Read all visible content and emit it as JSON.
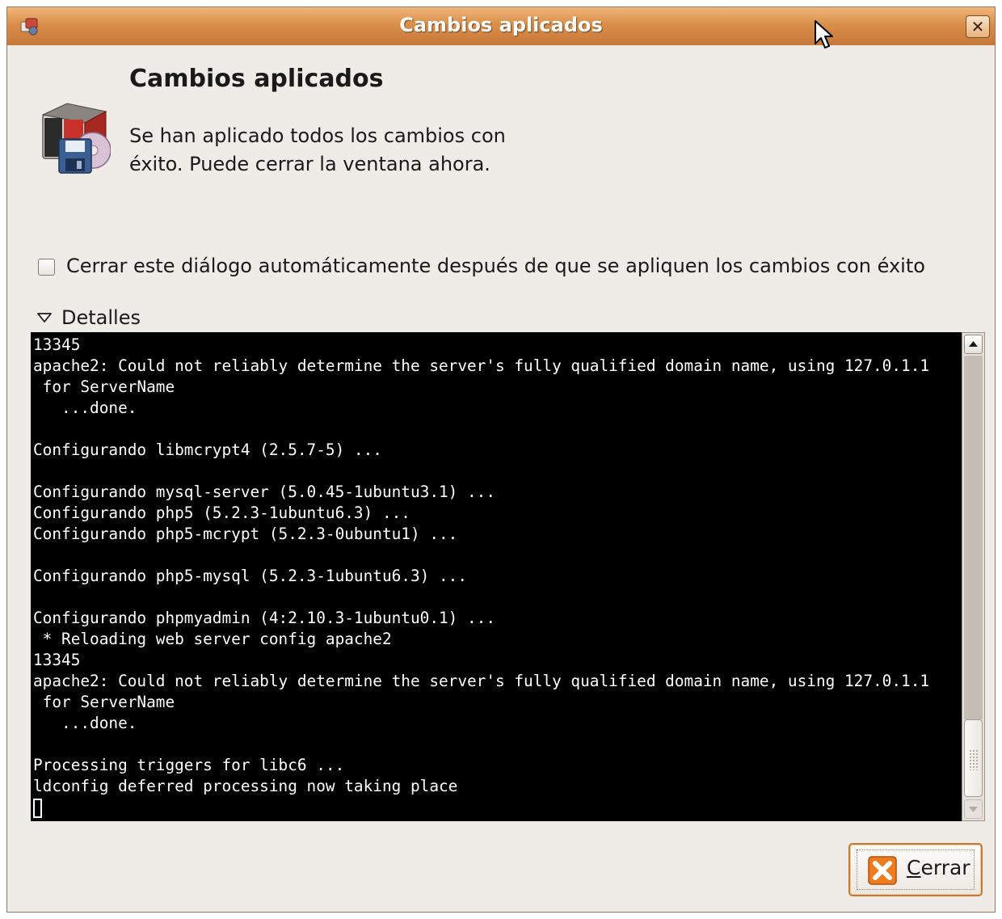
{
  "window": {
    "title": "Cambios aplicados",
    "close_glyph": "✕",
    "icons": [
      "window-menu-icon",
      "close-icon",
      "mouse-cursor-icon"
    ]
  },
  "dialog": {
    "heading": "Cambios aplicados",
    "message": "Se han aplicado todos los cambios con éxito. Puede cerrar la ventana ahora.",
    "icon": "package-installer-icon",
    "auto_close_checkbox": {
      "label": "Cerrar este diálogo automáticamente después de que se apliquen los cambios con éxito",
      "checked": false
    },
    "details": {
      "label": "Detalles",
      "expanded": true,
      "icon": "expander-arrow-down-icon"
    }
  },
  "terminal": {
    "lines": [
      "13345",
      "apache2: Could not reliably determine the server's fully qualified domain name, using 127.0.1.1",
      " for ServerName",
      "   ...done.",
      "",
      "Configurando libmcrypt4 (2.5.7-5) ...",
      "",
      "Configurando mysql-server (5.0.45-1ubuntu3.1) ...",
      "Configurando php5 (5.2.3-1ubuntu6.3) ...",
      "Configurando php5-mcrypt (5.2.3-0ubuntu1) ...",
      "",
      "Configurando php5-mysql (5.2.3-1ubuntu6.3) ...",
      "",
      "Configurando phpmyadmin (4:2.10.3-1ubuntu0.1) ...",
      " * Reloading web server config apache2",
      "13345",
      "apache2: Could not reliably determine the server's fully qualified domain name, using 127.0.1.1",
      " for ServerName",
      "   ...done.",
      "",
      "Processing triggers for libc6 ...",
      "ldconfig deferred processing now taking place"
    ]
  },
  "buttons": {
    "close": {
      "mnemonic": "C",
      "rest": "errar",
      "icon": "close-x-icon"
    }
  },
  "colors": {
    "titlebar": "#d98f4a",
    "window_bg": "#efebe7",
    "terminal_bg": "#000000",
    "terminal_fg": "#ffffff",
    "accent": "#f07a1e"
  }
}
